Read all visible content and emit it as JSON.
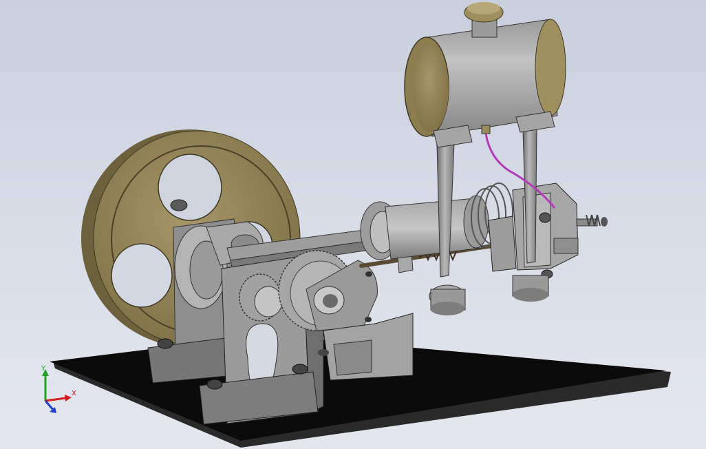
{
  "triad": {
    "x_label": "X",
    "y_label": "Y",
    "x_color": "#d11f1f",
    "y_color": "#1fa31f",
    "z_color": "#1f3fd1"
  },
  "colors": {
    "background_top": "#c9cfdd",
    "background_bottom": "#e4e7ee",
    "base_plate": "#0d0d0d",
    "steel": "#8f8f8f",
    "steel_light": "#b3b3b3",
    "brass": "#8a7a4e",
    "brass_light": "#a08f5e",
    "fuel_line": "#b23ab7"
  },
  "icons": [
    "coordinate-triad-icon"
  ]
}
